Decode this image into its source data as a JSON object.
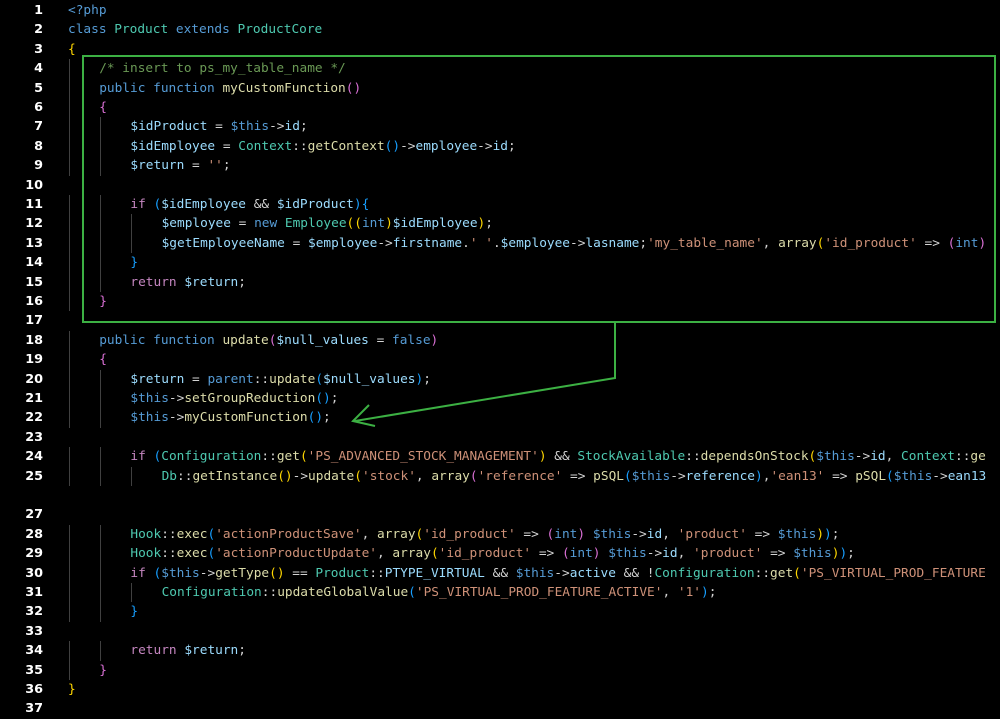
{
  "editor": {
    "language": "php",
    "colors": {
      "background": "#000000",
      "line_number": "#ffffff",
      "annotation": "#3cb043"
    },
    "lines": [
      {
        "n": "1",
        "indent": 0,
        "tokens": [
          [
            "php",
            "<?php"
          ]
        ]
      },
      {
        "n": "2",
        "indent": 0,
        "tokens": [
          [
            "kw",
            "class "
          ],
          [
            "cls",
            "Product "
          ],
          [
            "kw",
            "extends "
          ],
          [
            "cls",
            "ProductCore"
          ]
        ]
      },
      {
        "n": "3",
        "indent": 0,
        "tokens": [
          [
            "brace1",
            "{"
          ]
        ]
      },
      {
        "n": "4",
        "indent": 1,
        "tokens": [
          [
            "cmt",
            "/* insert to ps_my_table_name */"
          ]
        ]
      },
      {
        "n": "5",
        "indent": 1,
        "tokens": [
          [
            "kw",
            "public "
          ],
          [
            "kw",
            "function "
          ],
          [
            "fn",
            "myCustomFunction"
          ],
          [
            "brace2",
            "()"
          ]
        ]
      },
      {
        "n": "6",
        "indent": 1,
        "tokens": [
          [
            "brace2",
            "{"
          ]
        ]
      },
      {
        "n": "7",
        "indent": 2,
        "tokens": [
          [
            "var",
            "$idProduct"
          ],
          [
            "op",
            " = "
          ],
          [
            "this",
            "$this"
          ],
          [
            "op",
            "->"
          ],
          [
            "var",
            "id"
          ],
          [
            "op",
            ";"
          ]
        ]
      },
      {
        "n": "8",
        "indent": 2,
        "tokens": [
          [
            "var",
            "$idEmployee"
          ],
          [
            "op",
            " = "
          ],
          [
            "cls",
            "Context"
          ],
          [
            "op",
            "::"
          ],
          [
            "fn",
            "getContext"
          ],
          [
            "brace3",
            "()"
          ],
          [
            "op",
            "->"
          ],
          [
            "var",
            "employee"
          ],
          [
            "op",
            "->"
          ],
          [
            "var",
            "id"
          ],
          [
            "op",
            ";"
          ]
        ]
      },
      {
        "n": "9",
        "indent": 2,
        "tokens": [
          [
            "var",
            "$return"
          ],
          [
            "op",
            " = "
          ],
          [
            "str",
            "''"
          ],
          [
            "op",
            ";"
          ]
        ]
      },
      {
        "n": "10",
        "indent": 0,
        "tokens": []
      },
      {
        "n": "11",
        "indent": 2,
        "tokens": [
          [
            "kwc",
            "if "
          ],
          [
            "brace3",
            "("
          ],
          [
            "var",
            "$idEmployee"
          ],
          [
            "op",
            " && "
          ],
          [
            "var",
            "$idProduct"
          ],
          [
            "brace3",
            ")"
          ],
          [
            "brace3",
            "{"
          ]
        ]
      },
      {
        "n": "12",
        "indent": 3,
        "tokens": [
          [
            "var",
            "$employee"
          ],
          [
            "op",
            " = "
          ],
          [
            "kw",
            "new "
          ],
          [
            "cls",
            "Employee"
          ],
          [
            "brace1",
            "(("
          ],
          [
            "kw",
            "int"
          ],
          [
            "brace1",
            ")"
          ],
          [
            "var",
            "$idEmployee"
          ],
          [
            "brace1",
            ")"
          ],
          [
            "op",
            ";"
          ]
        ]
      },
      {
        "n": "13",
        "indent": 3,
        "tokens": [
          [
            "var",
            "$getEmployeeName"
          ],
          [
            "op",
            " = "
          ],
          [
            "var",
            "$employee"
          ],
          [
            "op",
            "->"
          ],
          [
            "var",
            "firstname"
          ],
          [
            "op",
            "."
          ],
          [
            "str",
            "' '"
          ],
          [
            "op",
            "."
          ],
          [
            "var",
            "$employee"
          ],
          [
            "op",
            "->"
          ],
          [
            "var",
            "lasname"
          ],
          [
            "op",
            ";"
          ],
          [
            "str",
            "'my_table_name'"
          ],
          [
            "op",
            ", "
          ],
          [
            "fn",
            "array"
          ],
          [
            "brace1",
            "("
          ],
          [
            "str",
            "'id_product'"
          ],
          [
            "op",
            " => "
          ],
          [
            "brace2",
            "("
          ],
          [
            "kw",
            "int"
          ],
          [
            "brace2",
            ")"
          ]
        ]
      },
      {
        "n": "14",
        "indent": 2,
        "tokens": [
          [
            "brace3",
            "}"
          ]
        ]
      },
      {
        "n": "15",
        "indent": 2,
        "tokens": [
          [
            "kwc",
            "return "
          ],
          [
            "var",
            "$return"
          ],
          [
            "op",
            ";"
          ]
        ]
      },
      {
        "n": "16",
        "indent": 1,
        "tokens": [
          [
            "brace2",
            "}"
          ]
        ]
      },
      {
        "n": "17",
        "indent": 0,
        "tokens": []
      },
      {
        "n": "18",
        "indent": 1,
        "tokens": [
          [
            "kw",
            "public "
          ],
          [
            "kw",
            "function "
          ],
          [
            "fn",
            "update"
          ],
          [
            "brace2",
            "("
          ],
          [
            "var",
            "$null_values"
          ],
          [
            "op",
            " = "
          ],
          [
            "kw",
            "false"
          ],
          [
            "brace2",
            ")"
          ]
        ]
      },
      {
        "n": "19",
        "indent": 1,
        "tokens": [
          [
            "brace2",
            "{"
          ]
        ]
      },
      {
        "n": "20",
        "indent": 2,
        "tokens": [
          [
            "var",
            "$return"
          ],
          [
            "op",
            " = "
          ],
          [
            "kw",
            "parent"
          ],
          [
            "op",
            "::"
          ],
          [
            "fn",
            "update"
          ],
          [
            "brace3",
            "("
          ],
          [
            "var",
            "$null_values"
          ],
          [
            "brace3",
            ")"
          ],
          [
            "op",
            ";"
          ]
        ]
      },
      {
        "n": "21",
        "indent": 2,
        "tokens": [
          [
            "this",
            "$this"
          ],
          [
            "op",
            "->"
          ],
          [
            "fn",
            "setGroupReduction"
          ],
          [
            "brace3",
            "()"
          ],
          [
            "op",
            ";"
          ]
        ]
      },
      {
        "n": "22",
        "indent": 2,
        "tokens": [
          [
            "this",
            "$this"
          ],
          [
            "op",
            "->"
          ],
          [
            "fn",
            "myCustomFunction"
          ],
          [
            "brace3",
            "()"
          ],
          [
            "op",
            ";"
          ]
        ]
      },
      {
        "n": "23",
        "indent": 0,
        "tokens": []
      },
      {
        "n": "24",
        "indent": 2,
        "tokens": [
          [
            "kwc",
            "if "
          ],
          [
            "brace3",
            "("
          ],
          [
            "cls",
            "Configuration"
          ],
          [
            "op",
            "::"
          ],
          [
            "fn",
            "get"
          ],
          [
            "brace1",
            "("
          ],
          [
            "str",
            "'PS_ADVANCED_STOCK_MANAGEMENT'"
          ],
          [
            "brace1",
            ")"
          ],
          [
            "op",
            " && "
          ],
          [
            "cls",
            "StockAvailable"
          ],
          [
            "op",
            "::"
          ],
          [
            "fn",
            "dependsOnStock"
          ],
          [
            "brace1",
            "("
          ],
          [
            "this",
            "$this"
          ],
          [
            "op",
            "->"
          ],
          [
            "var",
            "id"
          ],
          [
            "op",
            ", "
          ],
          [
            "cls",
            "Context"
          ],
          [
            "op",
            "::"
          ],
          [
            "fn",
            "ge"
          ]
        ]
      },
      {
        "n": "25",
        "indent": 3,
        "tokens": [
          [
            "cls",
            "Db"
          ],
          [
            "op",
            "::"
          ],
          [
            "fn",
            "getInstance"
          ],
          [
            "brace1",
            "()"
          ],
          [
            "op",
            "->"
          ],
          [
            "fn",
            "update"
          ],
          [
            "brace1",
            "("
          ],
          [
            "str",
            "'stock'"
          ],
          [
            "op",
            ", "
          ],
          [
            "fn",
            "array"
          ],
          [
            "brace2",
            "("
          ],
          [
            "str",
            "'reference'"
          ],
          [
            "op",
            " => "
          ],
          [
            "fn",
            "pSQL"
          ],
          [
            "brace3",
            "("
          ],
          [
            "this",
            "$this"
          ],
          [
            "op",
            "->"
          ],
          [
            "var",
            "reference"
          ],
          [
            "brace3",
            ")"
          ],
          [
            "op",
            ","
          ],
          [
            "str",
            "'ean13'"
          ],
          [
            "op",
            " => "
          ],
          [
            "fn",
            "pSQL"
          ],
          [
            "brace3",
            "("
          ],
          [
            "this",
            "$this"
          ],
          [
            "op",
            "->"
          ],
          [
            "var",
            "ean13"
          ]
        ]
      },
      {
        "n": "27",
        "indent": 0,
        "tokens": []
      },
      {
        "n": "28",
        "indent": 2,
        "tokens": [
          [
            "cls",
            "Hook"
          ],
          [
            "op",
            "::"
          ],
          [
            "fn",
            "exec"
          ],
          [
            "brace3",
            "("
          ],
          [
            "str",
            "'actionProductSave'"
          ],
          [
            "op",
            ", "
          ],
          [
            "fn",
            "array"
          ],
          [
            "brace1",
            "("
          ],
          [
            "str",
            "'id_product'"
          ],
          [
            "op",
            " => "
          ],
          [
            "brace2",
            "("
          ],
          [
            "kw",
            "int"
          ],
          [
            "brace2",
            ")"
          ],
          [
            "op",
            " "
          ],
          [
            "this",
            "$this"
          ],
          [
            "op",
            "->"
          ],
          [
            "var",
            "id"
          ],
          [
            "op",
            ", "
          ],
          [
            "str",
            "'product'"
          ],
          [
            "op",
            " => "
          ],
          [
            "this",
            "$this"
          ],
          [
            "brace1",
            ")"
          ],
          [
            "brace3",
            ")"
          ],
          [
            "op",
            ";"
          ]
        ]
      },
      {
        "n": "29",
        "indent": 2,
        "tokens": [
          [
            "cls",
            "Hook"
          ],
          [
            "op",
            "::"
          ],
          [
            "fn",
            "exec"
          ],
          [
            "brace3",
            "("
          ],
          [
            "str",
            "'actionProductUpdate'"
          ],
          [
            "op",
            ", "
          ],
          [
            "fn",
            "array"
          ],
          [
            "brace1",
            "("
          ],
          [
            "str",
            "'id_product'"
          ],
          [
            "op",
            " => "
          ],
          [
            "brace2",
            "("
          ],
          [
            "kw",
            "int"
          ],
          [
            "brace2",
            ")"
          ],
          [
            "op",
            " "
          ],
          [
            "this",
            "$this"
          ],
          [
            "op",
            "->"
          ],
          [
            "var",
            "id"
          ],
          [
            "op",
            ", "
          ],
          [
            "str",
            "'product'"
          ],
          [
            "op",
            " => "
          ],
          [
            "this",
            "$this"
          ],
          [
            "brace1",
            ")"
          ],
          [
            "brace3",
            ")"
          ],
          [
            "op",
            ";"
          ]
        ]
      },
      {
        "n": "30",
        "indent": 2,
        "tokens": [
          [
            "kwc",
            "if "
          ],
          [
            "brace3",
            "("
          ],
          [
            "this",
            "$this"
          ],
          [
            "op",
            "->"
          ],
          [
            "fn",
            "getType"
          ],
          [
            "brace1",
            "()"
          ],
          [
            "op",
            " == "
          ],
          [
            "cls",
            "Product"
          ],
          [
            "op",
            "::"
          ],
          [
            "var",
            "PTYPE_VIRTUAL"
          ],
          [
            "op",
            " && "
          ],
          [
            "this",
            "$this"
          ],
          [
            "op",
            "->"
          ],
          [
            "var",
            "active"
          ],
          [
            "op",
            " && !"
          ],
          [
            "cls",
            "Configuration"
          ],
          [
            "op",
            "::"
          ],
          [
            "fn",
            "get"
          ],
          [
            "brace1",
            "("
          ],
          [
            "str",
            "'PS_VIRTUAL_PROD_FEATURE"
          ]
        ]
      },
      {
        "n": "31",
        "indent": 3,
        "tokens": [
          [
            "cls",
            "Configuration"
          ],
          [
            "op",
            "::"
          ],
          [
            "fn",
            "updateGlobalValue"
          ],
          [
            "brace3",
            "("
          ],
          [
            "str",
            "'PS_VIRTUAL_PROD_FEATURE_ACTIVE'"
          ],
          [
            "op",
            ", "
          ],
          [
            "str",
            "'1'"
          ],
          [
            "brace3",
            ")"
          ],
          [
            "op",
            ";"
          ]
        ]
      },
      {
        "n": "32",
        "indent": 2,
        "tokens": [
          [
            "brace3",
            "}"
          ]
        ]
      },
      {
        "n": "33",
        "indent": 0,
        "tokens": []
      },
      {
        "n": "34",
        "indent": 2,
        "tokens": [
          [
            "kwc",
            "return "
          ],
          [
            "var",
            "$return"
          ],
          [
            "op",
            ";"
          ]
        ]
      },
      {
        "n": "35",
        "indent": 1,
        "tokens": [
          [
            "brace2",
            "}"
          ]
        ]
      },
      {
        "n": "36",
        "indent": 0,
        "tokens": [
          [
            "brace1",
            "}"
          ]
        ]
      },
      {
        "n": "37",
        "indent": 0,
        "tokens": []
      }
    ]
  }
}
